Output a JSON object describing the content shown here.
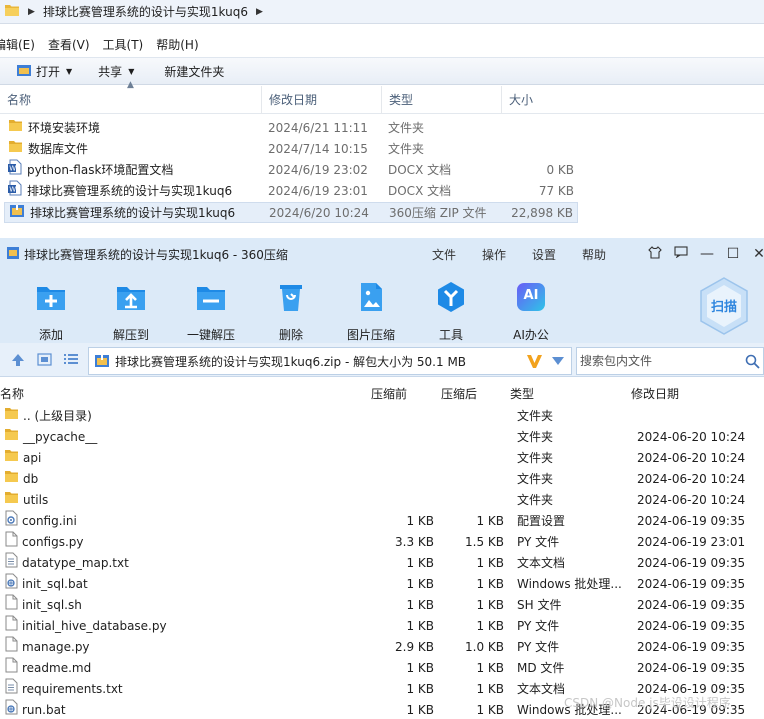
{
  "explorer": {
    "breadcrumb": "排球比赛管理系统的设计与实现1kuq6",
    "menu": [
      "编辑(E)",
      "查看(V)",
      "工具(T)",
      "帮助(H)"
    ],
    "toolbar": {
      "open": "打开",
      "share": "共享",
      "new_folder": "新建文件夹"
    },
    "columns": {
      "name": "名称",
      "date": "修改日期",
      "type": "类型",
      "size": "大小"
    },
    "rows": [
      {
        "name": "环境安装环境",
        "date": "2024/6/21 11:11",
        "type": "文件夹",
        "size": "",
        "icon": "folder-icon"
      },
      {
        "name": "数据库文件",
        "date": "2024/7/14 10:15",
        "type": "文件夹",
        "size": "",
        "icon": "folder-icon"
      },
      {
        "name": "python-flask环境配置文档",
        "date": "2024/6/19 23:02",
        "type": "DOCX 文档",
        "size": "0 KB",
        "icon": "word-doc-icon"
      },
      {
        "name": "排球比赛管理系统的设计与实现1kuq6",
        "date": "2024/6/19 23:01",
        "type": "DOCX 文档",
        "size": "77 KB",
        "icon": "word-doc-icon"
      },
      {
        "name": "排球比赛管理系统的设计与实现1kuq6",
        "date": "2024/6/20 10:24",
        "type": "360压缩 ZIP 文件",
        "size": "22,898 KB",
        "icon": "zip-archive-icon"
      }
    ]
  },
  "zip": {
    "title": "排球比赛管理系统的设计与实现1kuq6 - 360压缩",
    "menu": [
      "文件",
      "操作",
      "设置",
      "帮助"
    ],
    "toolbar": [
      {
        "label": "添加",
        "icon": "add-icon"
      },
      {
        "label": "解压到",
        "icon": "extract-to-icon"
      },
      {
        "label": "一键解压",
        "icon": "one-click-extract-icon"
      },
      {
        "label": "删除",
        "icon": "delete-icon"
      },
      {
        "label": "图片压缩",
        "icon": "image-compress-icon"
      },
      {
        "label": "工具",
        "icon": "tools-icon"
      },
      {
        "label": "AI办公",
        "icon": "ai-office-icon"
      }
    ],
    "scan_label": "扫描",
    "ai_badge": "AI",
    "path": "排球比赛管理系统的设计与实现1kuq6.zip - 解包大小为 50.1 MB",
    "search_placeholder": "搜索包内文件",
    "columns": {
      "name": "名称",
      "compressed": "压缩前",
      "original": "压缩后",
      "type": "类型",
      "date": "修改日期"
    },
    "rows": [
      {
        "name": ".. (上级目录)",
        "csz": "",
        "osz": "",
        "type": "文件夹",
        "date": "",
        "icon": "folder-icon"
      },
      {
        "name": "__pycache__",
        "csz": "",
        "osz": "",
        "type": "文件夹",
        "date": "2024-06-20 10:24",
        "icon": "folder-icon"
      },
      {
        "name": "api",
        "csz": "",
        "osz": "",
        "type": "文件夹",
        "date": "2024-06-20 10:24",
        "icon": "folder-icon"
      },
      {
        "name": "db",
        "csz": "",
        "osz": "",
        "type": "文件夹",
        "date": "2024-06-20 10:24",
        "icon": "folder-icon"
      },
      {
        "name": "utils",
        "csz": "",
        "osz": "",
        "type": "文件夹",
        "date": "2024-06-20 10:24",
        "icon": "folder-icon"
      },
      {
        "name": "config.ini",
        "csz": "1 KB",
        "osz": "1 KB",
        "type": "配置设置",
        "date": "2024-06-19 09:35",
        "icon": "settings-file-icon"
      },
      {
        "name": "configs.py",
        "csz": "3.3 KB",
        "osz": "1.5 KB",
        "type": "PY 文件",
        "date": "2024-06-19 23:01",
        "icon": "file-icon"
      },
      {
        "name": "datatype_map.txt",
        "csz": "1 KB",
        "osz": "1 KB",
        "type": "文本文档",
        "date": "2024-06-19 09:35",
        "icon": "text-file-icon"
      },
      {
        "name": "init_sql.bat",
        "csz": "1 KB",
        "osz": "1 KB",
        "type": "Windows 批处理...",
        "date": "2024-06-19 09:35",
        "icon": "bat-file-icon"
      },
      {
        "name": "init_sql.sh",
        "csz": "1 KB",
        "osz": "1 KB",
        "type": "SH 文件",
        "date": "2024-06-19 09:35",
        "icon": "file-icon"
      },
      {
        "name": "initial_hive_database.py",
        "csz": "1 KB",
        "osz": "1 KB",
        "type": "PY 文件",
        "date": "2024-06-19 09:35",
        "icon": "file-icon"
      },
      {
        "name": "manage.py",
        "csz": "2.9 KB",
        "osz": "1.0 KB",
        "type": "PY 文件",
        "date": "2024-06-19 09:35",
        "icon": "file-icon"
      },
      {
        "name": "readme.md",
        "csz": "1 KB",
        "osz": "1 KB",
        "type": "MD 文件",
        "date": "2024-06-19 09:35",
        "icon": "file-icon"
      },
      {
        "name": "requirements.txt",
        "csz": "1 KB",
        "osz": "1 KB",
        "type": "文本文档",
        "date": "2024-06-19 09:35",
        "icon": "text-file-icon"
      },
      {
        "name": "run.bat",
        "csz": "1 KB",
        "osz": "1 KB",
        "type": "Windows 批处理...",
        "date": "2024-06-19 09:35",
        "icon": "bat-file-icon"
      }
    ]
  },
  "watermark": "CSDN @Node.js毕设设计程序",
  "colors": {
    "accent": "#1e8ae6",
    "title_bg": "#dceaf8",
    "folder": "#f1c04f",
    "selection": "#e5eef9"
  }
}
